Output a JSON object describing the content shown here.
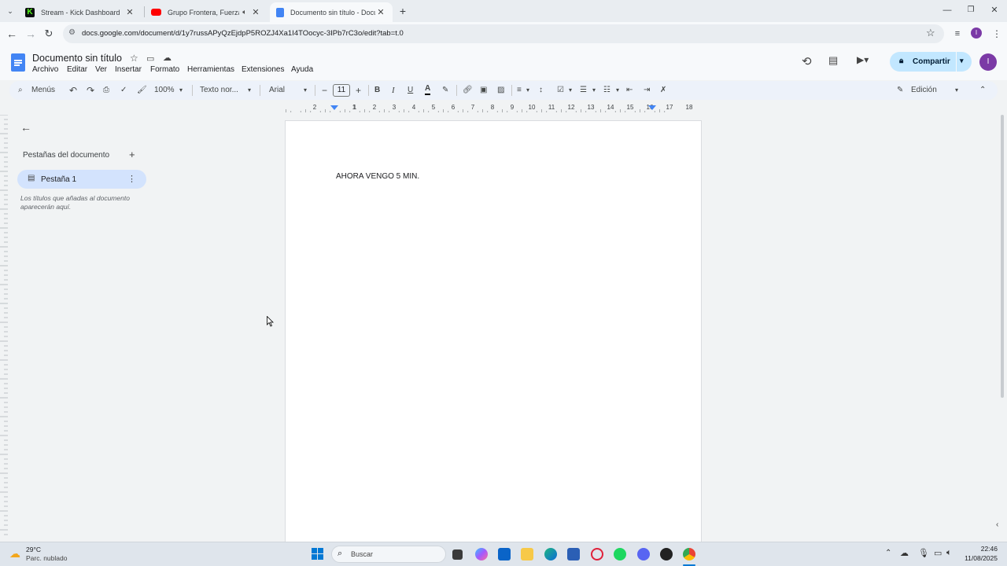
{
  "browser": {
    "tabs": [
      {
        "title": "Stream - Kick Dashboard",
        "favicon_color": "#53fc18",
        "favicon_text": "K"
      },
      {
        "title": "Grupo Frontera, Fuerza Reg",
        "favicon_color": "#ff0000"
      },
      {
        "title": "Documento sin título - Docume",
        "favicon_color": "#4285f4"
      }
    ],
    "url": "docs.google.com/document/d/1y7russAPyQzEjdpP5ROZJ4Xa1I4TOocyc-3IPb7rC3o/edit?tab=t.0"
  },
  "docs": {
    "title": "Documento sin título",
    "menus": [
      "Archivo",
      "Editar",
      "Ver",
      "Insertar",
      "Formato",
      "Herramientas",
      "Extensiones",
      "Ayuda"
    ],
    "share_label": "Compartir",
    "avatar_letter": "I",
    "toolbar": {
      "menus_search": "Menús",
      "zoom": "100%",
      "style": "Texto nor...",
      "font": "Arial",
      "font_size": "11",
      "mode": "Edición"
    },
    "ruler_numbers": [
      "2",
      "1",
      "1",
      "2",
      "3",
      "4",
      "5",
      "6",
      "7",
      "8",
      "9",
      "10",
      "11",
      "12",
      "13",
      "14",
      "15",
      "16",
      "17",
      "18"
    ],
    "sidebar": {
      "heading": "Pestañas del documento",
      "tab_label": "Pestaña 1",
      "hint": "Los títulos que añadas al documento aparecerán aquí."
    },
    "body_text": "AHORA VENGO 5 MIN."
  },
  "taskbar": {
    "weather_temp": "29°C",
    "weather_desc": "Parc. nublado",
    "search_placeholder": "Buscar",
    "time": "22:46",
    "date": "11/08/2025"
  },
  "colors": {
    "accent": "#1a73e8",
    "share_bg": "#c2e7ff",
    "selected_tab_bg": "#d3e3fd"
  }
}
